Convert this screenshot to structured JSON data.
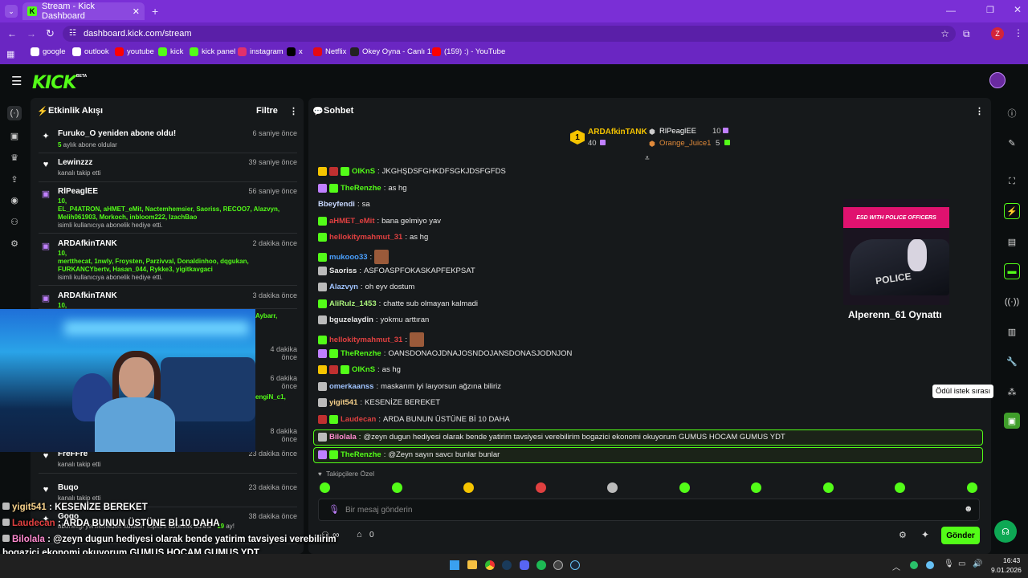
{
  "browser": {
    "tab_title": "Stream - Kick Dashboard",
    "new_tab": "+",
    "url": "dashboard.kick.com/stream",
    "profile_initial": "Z",
    "bookmarks": [
      {
        "label": "google",
        "icon": "google-icon",
        "color": "#ffffff"
      },
      {
        "label": "outlook",
        "icon": "outlook-icon",
        "color": "#ffffff"
      },
      {
        "label": "youtube",
        "icon": "youtube-icon",
        "color": "#ff0000"
      },
      {
        "label": "kick",
        "icon": "kick-icon",
        "color": "#53fc18"
      },
      {
        "label": "kick panel",
        "icon": "kick-icon",
        "color": "#53fc18"
      },
      {
        "label": "instagram",
        "icon": "instagram-icon",
        "color": "#e1306c"
      },
      {
        "label": "x",
        "icon": "x-icon",
        "color": "#000000"
      },
      {
        "label": "Netflix",
        "icon": "netflix-icon",
        "color": "#e50914"
      },
      {
        "label": "Okey Oyna - Canlı 1...",
        "icon": "okey-icon",
        "color": "#222222"
      },
      {
        "label": "(159) :) - YouTube",
        "icon": "youtube-icon",
        "color": "#ff0000"
      }
    ]
  },
  "header": {
    "logo": "KICK",
    "beta": "BETA"
  },
  "activity": {
    "title": "Etkinlik Akışı",
    "filter": "Filtre",
    "items": [
      {
        "name": "Furuko_O yeniden abone oldu!",
        "time": "6 saniye önce",
        "gl": "5",
        "sub": " aylık abone oldular",
        "icon": "sparkle-icon"
      },
      {
        "name": "Lewinzzz",
        "time": "39 saniye önce",
        "sub": "kanalı takip etti",
        "icon": "heart-icon"
      },
      {
        "name": "RlPeaglEE",
        "time": "56 saniye önce",
        "gl": "10,",
        "gl2": "EL_P4ATRON, aHMET_eMit, Nactemhemsier, Saoriss, RECOO7, Alazvyn,",
        "gl3": "Melih061903, Morkoch, inbloom222, IzachBao",
        "sub": "isimli kullanıcıya abonelik hediye etti.",
        "icon": "gift-icon"
      },
      {
        "name": "ARDAfkinTANK",
        "time": "2 dakika önce",
        "gl": "10,",
        "gl2": "mertthecat, 1nwly, Froysten, Parzivval, Donaldinhoo, dqgukan,",
        "gl3": "FURKANCYbertv, Hasan_044, Rykke3, yigitkavgaci",
        "sub": "isimli kullanıcıya abonelik hediye etti.",
        "icon": "gift-icon"
      },
      {
        "name": "ARDAfkinTANK",
        "time": "3 dakika önce",
        "gl": "10,",
        "icon": "gift-icon"
      },
      {
        "name": "FreFFre",
        "time": "23 dakika önce",
        "sub": "kanalı takip etti",
        "icon": "heart-icon"
      },
      {
        "name": "Buqo",
        "time": "23 dakika önce",
        "sub": "kanalı takip etti",
        "icon": "heart-icon"
      },
      {
        "name": "Gogo",
        "time": "38 dakika önce",
        "sub": "aboneliği yenilemeden kutladı! Toplam abonelik süresi - ",
        "gl": "19",
        "sub2": " ay!",
        "icon": "sparkle-icon"
      }
    ],
    "partial": {
      "t1": "4 dakika önce",
      "t2": "6 dakika önce",
      "t3": "8 dakika önce",
      "g1": "Aybarr,",
      "g2": "engiN_c1,"
    }
  },
  "chat": {
    "title": "Sohbet",
    "top_gifters": [
      {
        "rank": "1",
        "name": "ARDAfkinTANK",
        "count": "40"
      },
      {
        "name": "RlPeaglEE",
        "count": "10"
      },
      {
        "name": "Orange_Juice1",
        "count": "5"
      }
    ],
    "messages": [
      {
        "user": "OlKnS",
        "color": "#53fc18",
        "text": "JKGHŞDSFGHKDFSGKJDSFGFDS",
        "badges": [
          "#f5c400",
          "#c03030",
          "#53fc18"
        ]
      },
      {
        "user": "TheRenzhe",
        "color": "#53fc18",
        "text": "as hg",
        "badges": [
          "#c080ff",
          "#53fc18"
        ]
      },
      {
        "user": "Bbeyfendi",
        "color": "#c8d8ff",
        "text": "sa",
        "badges": []
      },
      {
        "user": "aHMET_eMit",
        "color": "#e04040",
        "text": "bana gelmiyo yav",
        "badges": [
          "#53fc18"
        ]
      },
      {
        "user": "hellokitymahmut_31",
        "color": "#e04040",
        "text": "as hg",
        "badges": [
          "#53fc18"
        ]
      },
      {
        "user": "mukooo33",
        "color": "#4aa0ff",
        "text": "",
        "badges": [
          "#53fc18"
        ],
        "emote": true
      },
      {
        "user": "Saoriss",
        "color": "#e8e8e8",
        "text": "ASFOASPFOKASKAPFEKPSAT",
        "badges": [
          "#bbbbbb"
        ]
      },
      {
        "user": "Alazvyn",
        "color": "#a0c4ff",
        "text": "oh eyv dostum",
        "badges": [
          "#bbbbbb"
        ]
      },
      {
        "user": "AliRulz_1453",
        "color": "#a8f07a",
        "text": "chatte sub olmayan kalmadi",
        "badges": [
          "#53fc18"
        ]
      },
      {
        "user": "bguzelaydin",
        "color": "#e8e8e8",
        "text": "yokmu arttıran",
        "badges": [
          "#bbbbbb"
        ]
      },
      {
        "user": "hellokitymahmut_31",
        "color": "#e04040",
        "text": "",
        "badges": [
          "#53fc18"
        ],
        "emote": true
      },
      {
        "user": "TheRenzhe",
        "color": "#53fc18",
        "text": "OANSDONAOJDNAJOSNDOJANSDONASJODNJON",
        "badges": [
          "#c080ff",
          "#53fc18"
        ]
      },
      {
        "user": "OlKnS",
        "color": "#53fc18",
        "text": "as hg",
        "badges": [
          "#f5c400",
          "#c03030",
          "#53fc18"
        ]
      },
      {
        "user": "omerkaanss",
        "color": "#a0c4ff",
        "text": "maskarım iyi laıyorsun ağzına biliriz",
        "badges": [
          "#bbbbbb"
        ]
      },
      {
        "user": "yigit541",
        "color": "#f5d08a",
        "text": "KESENİZE BEREKET",
        "badges": [
          "#bbbbbb"
        ]
      },
      {
        "user": "Laudecan",
        "color": "#e04040",
        "text": "ARDA BUNUN ÜSTÜNE Bİ 10 DAHA",
        "badges": [
          "#c03030",
          "#53fc18"
        ]
      }
    ],
    "highlighted": [
      {
        "user": "Bilolala",
        "color": "#ff8ad0",
        "text": "@zeyn dugun hediyesi olarak bende yatirim tavsiyesi verebilirim bogazici ekonomi okuyorum GUMUS HOCAM GUMUS YDT",
        "badges": [
          "#bbbbbb"
        ]
      },
      {
        "user": "TheRenzhe",
        "color": "#53fc18",
        "text": "@Zeyn sayın savcı bunlar bunlar",
        "badges": [
          "#c080ff",
          "#53fc18"
        ]
      }
    ],
    "emote_bar_label": "Takipçilere Özel",
    "input_placeholder": "Bir mesaj gönderin",
    "points": "0",
    "infinity": "∞",
    "send": "Gönder"
  },
  "stream_preview": {
    "banner": "ESD WITH POLICE OFFICERS",
    "police": "POLICE",
    "game_caption": "Alperenn_61 Oynattı"
  },
  "tooltip": "Ödül istek sırası",
  "overlay_chat": [
    {
      "user": "yigit541",
      "text": "KESENİZE BEREKET",
      "color": "#f5d08a"
    },
    {
      "user": "Laudecan",
      "text": "ARDA BUNUN ÜSTÜNE Bİ 10 DAHA",
      "color": "#e04040"
    },
    {
      "user": "Bilolala",
      "text": "@zeyn dugun hediyesi olarak bende yatirim tavsiyesi verebilirim",
      "text2": "bogazici ekonomi okuyorum GUMUS HOCAM GUMUS YDT",
      "color": "#ff8ad0"
    },
    {
      "user": "TheRenzhe",
      "text": "@Zeyn sayın savcı bunlar bunlar",
      "color": "#53fc18"
    }
  ],
  "taskbar": {
    "time": "16:43",
    "date": "9.01.2026"
  }
}
